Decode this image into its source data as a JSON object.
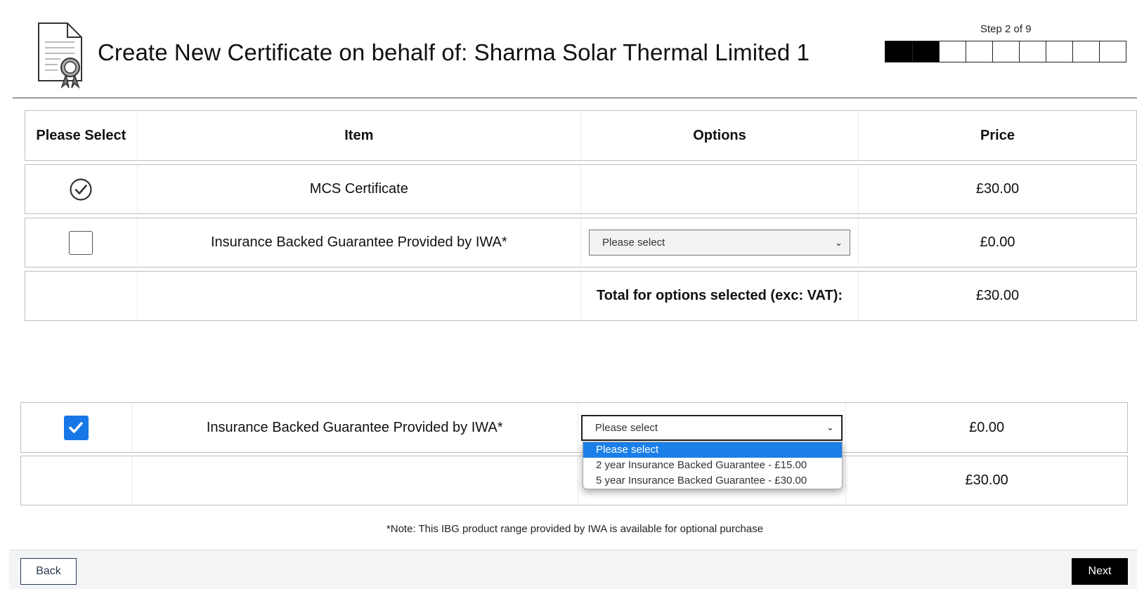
{
  "header": {
    "title": "Create New Certificate on behalf of: Sharma Solar Thermal Limited 1",
    "step_label": "Step 2 of 9",
    "progress": {
      "current_step": 2,
      "total_steps": 9
    }
  },
  "table": {
    "headers": [
      "Please Select",
      "Item",
      "Options",
      "Price"
    ],
    "rows": [
      {
        "item": "MCS Certificate",
        "price": "£30.00",
        "selected": true
      },
      {
        "item": "Insurance Backed Guarantee Provided by IWA*",
        "option_value": "Please select",
        "price": "£0.00",
        "selected": false
      }
    ],
    "total_label": "Total for options selected (exc: VAT):",
    "total_price": "£30.00"
  },
  "ibg_panel": {
    "item": "Insurance Backed Guarantee Provided by IWA*",
    "option_value": "Please select",
    "price": "£0.00",
    "selected": true,
    "total_price": "£30.00",
    "dropdown_options": [
      "Please select",
      "2 year Insurance Backed Guarantee - £15.00",
      "5 year Insurance Backed Guarantee - £30.00"
    ],
    "highlighted_option_index": 0
  },
  "note": "*Note: This IBG product range provided by IWA is available for optional purchase",
  "footer": {
    "back_label": "Back",
    "next_label": "Next"
  },
  "colors": {
    "checkbox_accent": "#1877e6",
    "highlight": "#1a7fe8",
    "primary_button": "#000000"
  },
  "icons": [
    "certificate-icon",
    "check-circle-icon",
    "checkmark-icon",
    "chevron-down-icon"
  ]
}
